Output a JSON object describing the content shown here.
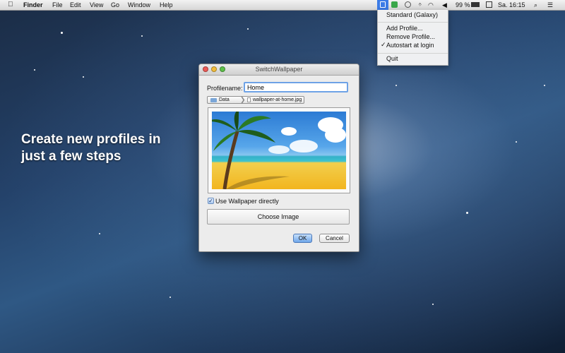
{
  "menubar": {
    "apple_icon": "apple-logo",
    "app_name": "Finder",
    "menus": [
      "File",
      "Edit",
      "View",
      "Go",
      "Window",
      "Help"
    ],
    "battery_percent": "99 %",
    "clock": "Sa. 16:15",
    "tray_icons": [
      "switchwallpaper-icon",
      "evernote-icon",
      "time-machine-icon",
      "bluetooth-icon",
      "wifi-icon",
      "volume-icon",
      "battery-icon",
      "input-source-icon",
      "spotlight-icon",
      "notification-center-icon"
    ]
  },
  "dropdown": {
    "current_profile": "Standard (Galaxy)",
    "add_profile": "Add Profile...",
    "remove_profile": "Remove Profile...",
    "autostart": "Autostart at login",
    "autostart_checked": true,
    "quit": "Quit"
  },
  "caption": {
    "line1": "Create new profiles in",
    "line2": "just a few steps"
  },
  "window": {
    "title": "SwitchWallpaper",
    "profile_label": "Profilename:",
    "profile_value": "Home",
    "path_folder": "Data",
    "path_file": "wallpaper-at-home.jpg",
    "use_wallpaper_label": "Use Wallpaper directly",
    "use_wallpaper_checked": true,
    "choose_image": "Choose Image",
    "ok": "OK",
    "cancel": "Cancel"
  },
  "colors": {
    "menu_highlight": "#3b7be6",
    "focus_ring": "#6ea2e6",
    "default_button": "#6fa7ea"
  }
}
